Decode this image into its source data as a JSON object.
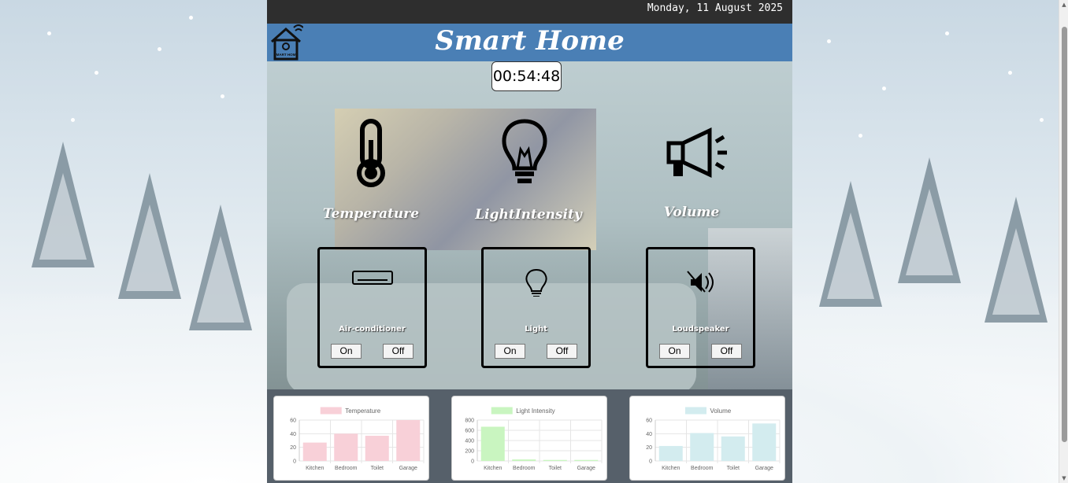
{
  "header": {
    "date": "Monday, 11 August 2025",
    "title": "Smart Home",
    "logo_text": "SMART HOME",
    "clock": "00:54:48"
  },
  "sensors": [
    {
      "label": "Temperature",
      "icon": "thermometer-icon"
    },
    {
      "label": "LightIntensity",
      "icon": "lightbulb-icon"
    },
    {
      "label": "Volume",
      "icon": "megaphone-icon"
    }
  ],
  "devices": [
    {
      "label": "Air-conditioner",
      "icon": "air-conditioner-icon",
      "on_label": "On",
      "off_label": "Off"
    },
    {
      "label": "Light",
      "icon": "lightbulb-icon",
      "on_label": "On",
      "off_label": "Off"
    },
    {
      "label": "Loudspeaker",
      "icon": "speaker-muted-icon",
      "on_label": "On",
      "off_label": "Off"
    }
  ],
  "chart_data": [
    {
      "type": "bar",
      "title": "",
      "legend": "Temperature",
      "categories": [
        "Kitchen",
        "Bedroom",
        "Toilet",
        "Garage"
      ],
      "values": [
        27,
        40,
        37,
        60
      ],
      "ylim": [
        0,
        60
      ],
      "yticks": [
        "0",
        "20",
        "40",
        "60"
      ],
      "color": "#f8d0d8"
    },
    {
      "type": "bar",
      "title": "",
      "legend": "Light Intensity",
      "categories": [
        "Kitchen",
        "Bedroom",
        "Toilet",
        "Garage"
      ],
      "values": [
        670,
        30,
        20,
        20
      ],
      "ylim": [
        0,
        800
      ],
      "yticks": [
        "0",
        "200",
        "400",
        "600",
        "800"
      ],
      "color": "#c9f5c0"
    },
    {
      "type": "bar",
      "title": "",
      "legend": "Volume",
      "categories": [
        "Kitchen",
        "Bedroom",
        "Toilet",
        "Garage"
      ],
      "values": [
        22,
        41,
        36,
        55
      ],
      "ylim": [
        0,
        60
      ],
      "yticks": [
        "0",
        "20",
        "40",
        "60"
      ],
      "color": "#d3ecef"
    }
  ]
}
